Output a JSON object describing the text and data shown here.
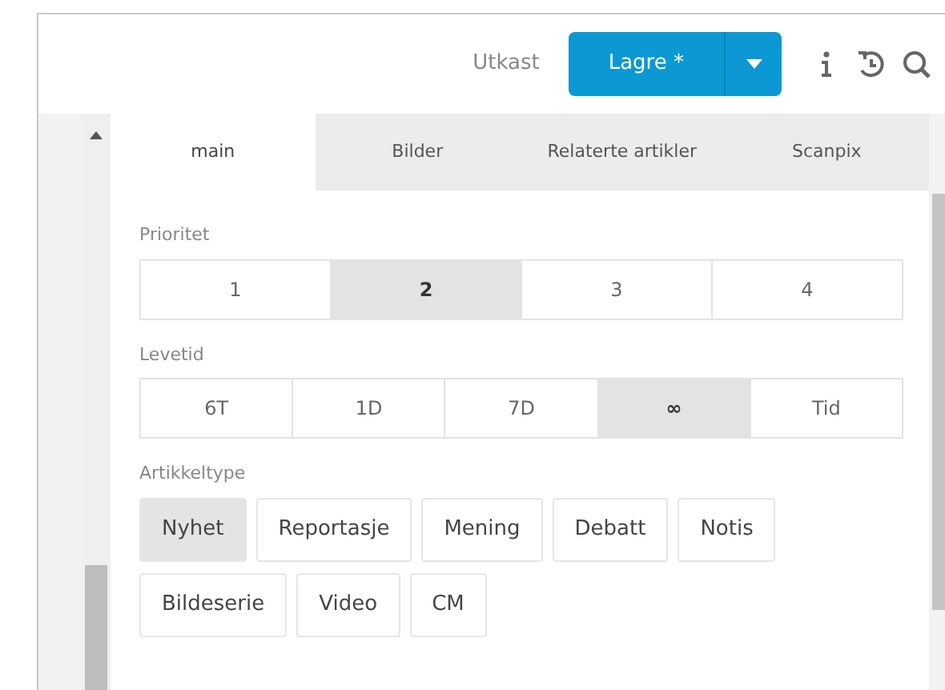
{
  "toolbar": {
    "status": "Utkast",
    "save_button": "Lagre *"
  },
  "tabs": [
    {
      "label": "main",
      "selected": true
    },
    {
      "label": "Bilder",
      "selected": false
    },
    {
      "label": "Relaterte artikler",
      "selected": false
    },
    {
      "label": "Scanpix",
      "selected": false
    }
  ],
  "groups": [
    {
      "label": "Prioritet",
      "kind": "segmented",
      "options": [
        {
          "label": "1",
          "selected": false
        },
        {
          "label": "2",
          "selected": true
        },
        {
          "label": "3",
          "selected": false
        },
        {
          "label": "4",
          "selected": false
        }
      ]
    },
    {
      "label": "Levetid",
      "kind": "segmented",
      "options": [
        {
          "label": "6T",
          "selected": false
        },
        {
          "label": "1D",
          "selected": false
        },
        {
          "label": "7D",
          "selected": false
        },
        {
          "label": "∞",
          "selected": true
        },
        {
          "label": "Tid",
          "selected": false
        }
      ]
    },
    {
      "label": "Artikkeltype",
      "kind": "chips",
      "options": [
        {
          "label": "Nyhet",
          "selected": true
        },
        {
          "label": "Reportasje",
          "selected": false
        },
        {
          "label": "Mening",
          "selected": false
        },
        {
          "label": "Debatt",
          "selected": false
        },
        {
          "label": "Notis",
          "selected": false
        },
        {
          "label": "Bildeserie",
          "selected": false
        },
        {
          "label": "Video",
          "selected": false
        },
        {
          "label": "CM",
          "selected": false
        }
      ]
    }
  ]
}
